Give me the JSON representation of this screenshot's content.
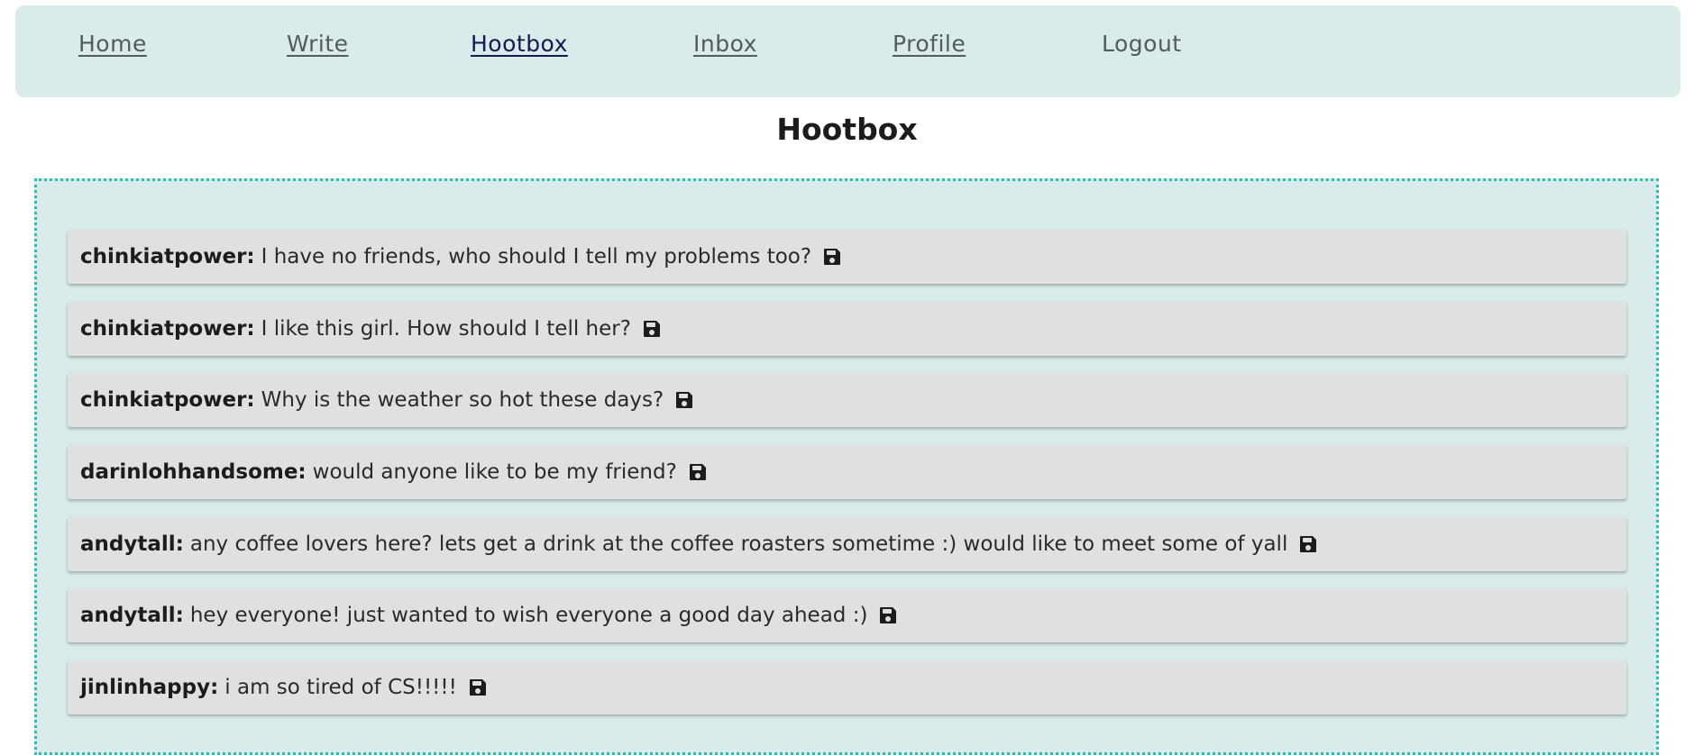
{
  "nav": {
    "items": [
      {
        "label": "Home"
      },
      {
        "label": "Write"
      },
      {
        "label": "Hootbox"
      },
      {
        "label": "Inbox"
      },
      {
        "label": "Profile"
      },
      {
        "label": "Logout"
      }
    ],
    "active": "Hootbox"
  },
  "page": {
    "title": "Hootbox"
  },
  "posts": [
    {
      "author": "chinkiatpower:",
      "message": "I have no friends, who should I tell my problems too?",
      "icon": "save-icon"
    },
    {
      "author": "chinkiatpower:",
      "message": "I like this girl. How should I tell her?",
      "icon": "save-icon"
    },
    {
      "author": "chinkiatpower:",
      "message": "Why is the weather so hot these days?",
      "icon": "save-icon"
    },
    {
      "author": "darinlohhandsome:",
      "message": "would anyone like to be my friend?",
      "icon": "save-icon"
    },
    {
      "author": "andytall:",
      "message": "any coffee lovers here? lets get a drink at the coffee roasters sometime :) would like to meet some of yall",
      "icon": "save-icon"
    },
    {
      "author": "andytall:",
      "message": "hey everyone! just wanted to wish everyone a good day ahead :)",
      "icon": "save-icon"
    },
    {
      "author": "jinlinhappy:",
      "message": "i am so tired of CS!!!!!",
      "icon": "save-icon"
    }
  ],
  "colors": {
    "nav_bg": "#d9ebea",
    "panel_bg": "#d9ebea",
    "panel_border": "#27c0b3",
    "post_bg": "#e0e0e0"
  }
}
